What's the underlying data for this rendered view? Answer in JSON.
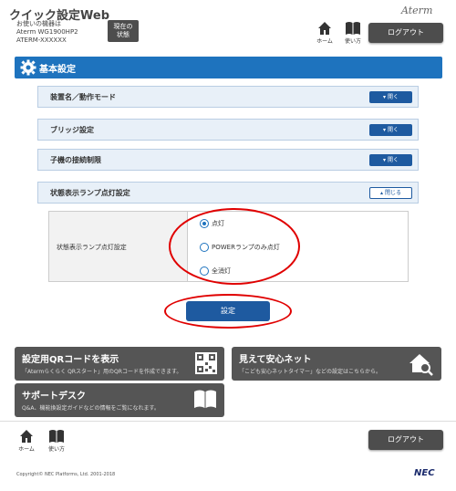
{
  "header": {
    "app_title": "クイック設定Web",
    "device_line1": "お使いの機器は",
    "device_line2": "Aterm WG1900HP2",
    "device_line3": "ATERM-XXXXXX",
    "status_button_line1": "現在の",
    "status_button_line2": "状態",
    "brand": "Aterm",
    "home_label": "ホーム",
    "help_label": "使い方",
    "logout_label": "ログアウト"
  },
  "section": {
    "title": "基本設定"
  },
  "accordion": [
    {
      "label": "装置名／動作モード",
      "button": "開く"
    },
    {
      "label": "ブリッジ設定",
      "button": "開く"
    },
    {
      "label": "子機の接続制限",
      "button": "開く"
    },
    {
      "label": "状態表示ランプ点灯設定",
      "button": "閉じる"
    }
  ],
  "lamp_setting": {
    "label": "状態表示ランプ点灯設定",
    "options": [
      "点灯",
      "POWERランプのみ点灯",
      "全消灯"
    ],
    "selected": "点灯"
  },
  "submit_label": "設定",
  "cards": {
    "qr": {
      "title": "設定用QRコードを表示",
      "desc": "「Atermらくらく QRスタート」用のQRコードを作成できます。"
    },
    "safe_net": {
      "title": "見えて安心ネット",
      "desc": "「こども安心ネットタイマー」などの設定はこちらから。"
    },
    "support": {
      "title": "サポートデスク",
      "desc": "Q&A、機能換設定ガイドなどの情報をご覧になれます。"
    }
  },
  "footer": {
    "home_label": "ホーム",
    "help_label": "使い方",
    "logout_label": "ログアウト",
    "copyright": "Copyright© NEC Platforms, Ltd. 2001-2018",
    "logo": "NEC"
  },
  "colors": {
    "primary": "#1e73be",
    "dark_button": "#4d4d4d",
    "annotation": "#e00000"
  }
}
